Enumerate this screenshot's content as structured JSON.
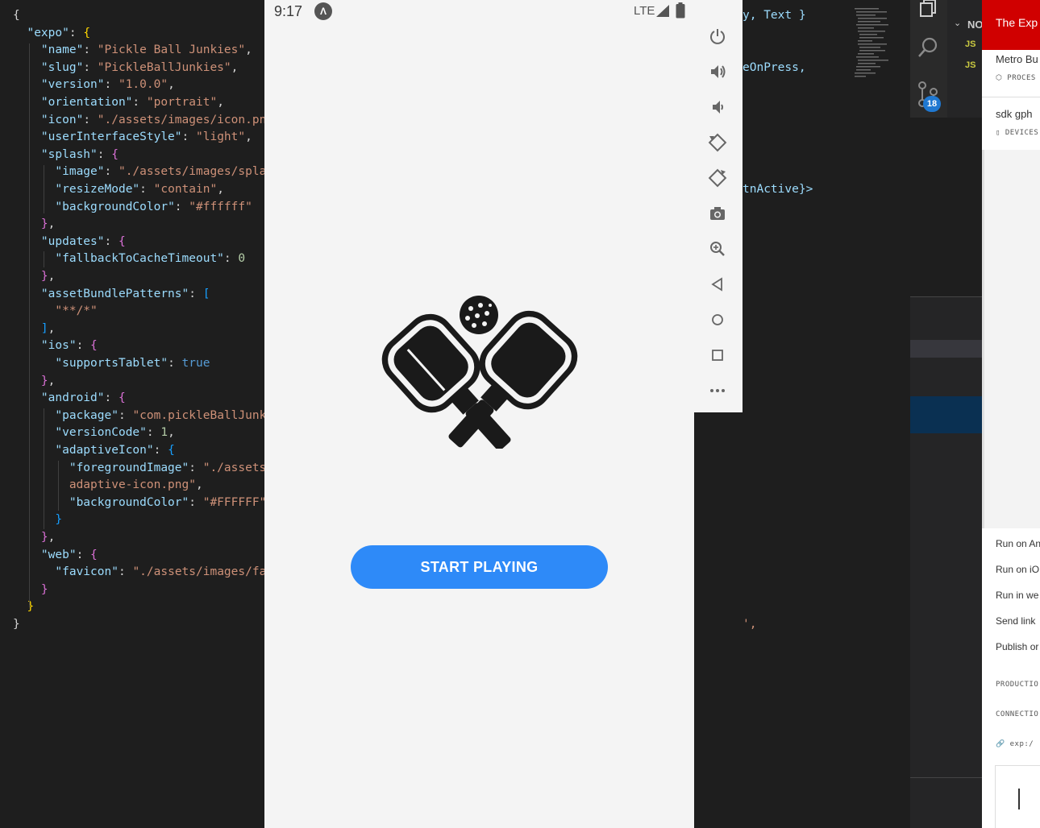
{
  "editor": {
    "lines": [
      {
        "parts": [
          [
            "p",
            "{"
          ]
        ]
      },
      {
        "parts": [
          [
            "p",
            "  "
          ],
          [
            "k",
            "\"expo\""
          ],
          [
            "p",
            ": "
          ],
          [
            "br1",
            "{"
          ]
        ]
      },
      {
        "parts": [
          [
            "p",
            "    "
          ],
          [
            "k",
            "\"name\""
          ],
          [
            "p",
            ": "
          ],
          [
            "s",
            "\"Pickle Ball Junkies\""
          ],
          [
            "p",
            ","
          ]
        ]
      },
      {
        "parts": [
          [
            "p",
            "    "
          ],
          [
            "k",
            "\"slug\""
          ],
          [
            "p",
            ": "
          ],
          [
            "s",
            "\"PickleBallJunkies\""
          ],
          [
            "p",
            ","
          ]
        ]
      },
      {
        "parts": [
          [
            "p",
            "    "
          ],
          [
            "k",
            "\"version\""
          ],
          [
            "p",
            ": "
          ],
          [
            "s",
            "\"1.0.0\""
          ],
          [
            "p",
            ","
          ]
        ]
      },
      {
        "parts": [
          [
            "p",
            "    "
          ],
          [
            "k",
            "\"orientation\""
          ],
          [
            "p",
            ": "
          ],
          [
            "s",
            "\"portrait\""
          ],
          [
            "p",
            ","
          ]
        ]
      },
      {
        "parts": [
          [
            "p",
            "    "
          ],
          [
            "k",
            "\"icon\""
          ],
          [
            "p",
            ": "
          ],
          [
            "s",
            "\"./assets/images/icon.pn"
          ]
        ]
      },
      {
        "parts": [
          [
            "p",
            "    "
          ],
          [
            "k",
            "\"userInterfaceStyle\""
          ],
          [
            "p",
            ": "
          ],
          [
            "s",
            "\"light\""
          ],
          [
            "p",
            ","
          ]
        ]
      },
      {
        "parts": [
          [
            "p",
            "    "
          ],
          [
            "k",
            "\"splash\""
          ],
          [
            "p",
            ": "
          ],
          [
            "br2",
            "{"
          ]
        ]
      },
      {
        "parts": [
          [
            "p",
            "      "
          ],
          [
            "k",
            "\"image\""
          ],
          [
            "p",
            ": "
          ],
          [
            "s",
            "\"./assets/images/spla"
          ]
        ]
      },
      {
        "parts": [
          [
            "p",
            "      "
          ],
          [
            "k",
            "\"resizeMode\""
          ],
          [
            "p",
            ": "
          ],
          [
            "s",
            "\"contain\""
          ],
          [
            "p",
            ","
          ]
        ]
      },
      {
        "parts": [
          [
            "p",
            "      "
          ],
          [
            "k",
            "\"backgroundColor\""
          ],
          [
            "p",
            ": "
          ],
          [
            "s",
            "\"#ffffff\""
          ]
        ]
      },
      {
        "parts": [
          [
            "p",
            "    "
          ],
          [
            "br2",
            "}"
          ],
          [
            "p",
            ","
          ]
        ]
      },
      {
        "parts": [
          [
            "p",
            "    "
          ],
          [
            "k",
            "\"updates\""
          ],
          [
            "p",
            ": "
          ],
          [
            "br2",
            "{"
          ]
        ]
      },
      {
        "parts": [
          [
            "p",
            "      "
          ],
          [
            "k",
            "\"fallbackToCacheTimeout\""
          ],
          [
            "p",
            ": "
          ],
          [
            "n",
            "0"
          ]
        ]
      },
      {
        "parts": [
          [
            "p",
            "    "
          ],
          [
            "br2",
            "}"
          ],
          [
            "p",
            ","
          ]
        ]
      },
      {
        "parts": [
          [
            "p",
            "    "
          ],
          [
            "k",
            "\"assetBundlePatterns\""
          ],
          [
            "p",
            ": "
          ],
          [
            "br3",
            "["
          ]
        ]
      },
      {
        "parts": [
          [
            "p",
            "      "
          ],
          [
            "s",
            "\"**/*\""
          ]
        ]
      },
      {
        "parts": [
          [
            "p",
            "    "
          ],
          [
            "br3",
            "]"
          ],
          [
            "p",
            ","
          ]
        ]
      },
      {
        "parts": [
          [
            "p",
            "    "
          ],
          [
            "k",
            "\"ios\""
          ],
          [
            "p",
            ": "
          ],
          [
            "br2",
            "{"
          ]
        ]
      },
      {
        "parts": [
          [
            "p",
            "      "
          ],
          [
            "k",
            "\"supportsTablet\""
          ],
          [
            "p",
            ": "
          ],
          [
            "b",
            "true"
          ]
        ]
      },
      {
        "parts": [
          [
            "p",
            "    "
          ],
          [
            "br2",
            "}"
          ],
          [
            "p",
            ","
          ]
        ]
      },
      {
        "parts": [
          [
            "p",
            "    "
          ],
          [
            "k",
            "\"android\""
          ],
          [
            "p",
            ": "
          ],
          [
            "br2",
            "{"
          ]
        ]
      },
      {
        "parts": [
          [
            "p",
            "      "
          ],
          [
            "k",
            "\"package\""
          ],
          [
            "p",
            ": "
          ],
          [
            "s",
            "\"com.pickleBallJunk"
          ]
        ]
      },
      {
        "parts": [
          [
            "p",
            "      "
          ],
          [
            "k",
            "\"versionCode\""
          ],
          [
            "p",
            ": "
          ],
          [
            "n",
            "1"
          ],
          [
            "p",
            ","
          ]
        ]
      },
      {
        "parts": [
          [
            "p",
            "      "
          ],
          [
            "k",
            "\"adaptiveIcon\""
          ],
          [
            "p",
            ": "
          ],
          [
            "br3",
            "{"
          ]
        ]
      },
      {
        "parts": [
          [
            "p",
            "        "
          ],
          [
            "k",
            "\"foregroundImage\""
          ],
          [
            "p",
            ": "
          ],
          [
            "s",
            "\"./assets"
          ]
        ]
      },
      {
        "parts": [
          [
            "p",
            "        "
          ],
          [
            "s",
            "adaptive-icon.png\""
          ],
          [
            "p",
            ","
          ]
        ]
      },
      {
        "parts": [
          [
            "p",
            "        "
          ],
          [
            "k",
            "\"backgroundColor\""
          ],
          [
            "p",
            ": "
          ],
          [
            "s",
            "\"#FFFFFF\""
          ]
        ]
      },
      {
        "parts": [
          [
            "p",
            "      "
          ],
          [
            "br3",
            "}"
          ]
        ]
      },
      {
        "parts": [
          [
            "p",
            "    "
          ],
          [
            "br2",
            "}"
          ],
          [
            "p",
            ","
          ]
        ]
      },
      {
        "parts": [
          [
            "p",
            "    "
          ],
          [
            "k",
            "\"web\""
          ],
          [
            "p",
            ": "
          ],
          [
            "br2",
            "{"
          ]
        ]
      },
      {
        "parts": [
          [
            "p",
            "      "
          ],
          [
            "k",
            "\"favicon\""
          ],
          [
            "p",
            ": "
          ],
          [
            "s",
            "\"./assets/images/fa"
          ]
        ]
      },
      {
        "parts": [
          [
            "p",
            "    "
          ],
          [
            "br2",
            "}"
          ]
        ]
      },
      {
        "parts": [
          [
            "p",
            "  "
          ],
          [
            "br1",
            "}"
          ]
        ]
      },
      {
        "parts": [
          [
            "p",
            "}"
          ]
        ]
      }
    ]
  },
  "phone": {
    "time": "9:17",
    "network": "LTE",
    "expo_badge": "Λ",
    "start_button": "START PLAYING"
  },
  "emulator_toolbar": {
    "close": "×",
    "minimize": "−"
  },
  "code_right": {
    "line1": "y, Text }",
    "line2": "eOnPress,",
    "line3": "tnActive}>",
    "line4": "',"
  },
  "activity_bar": {
    "badge": "18"
  },
  "explorer": {
    "section": "NO",
    "file1": "JS",
    "file2": "JS"
  },
  "devtools": {
    "title": "The Exp",
    "metro": "Metro Bu",
    "process": "PROCES",
    "sdk": "sdk gph",
    "devices": "DEVICES",
    "run_android": "Run on An",
    "run_ios": "Run on iO",
    "run_web": "Run in we",
    "send_link": "Send link",
    "publish": "Publish or",
    "production": "PRODUCTIO",
    "connection": "CONNECTIO",
    "exp_url": "exp:/"
  }
}
